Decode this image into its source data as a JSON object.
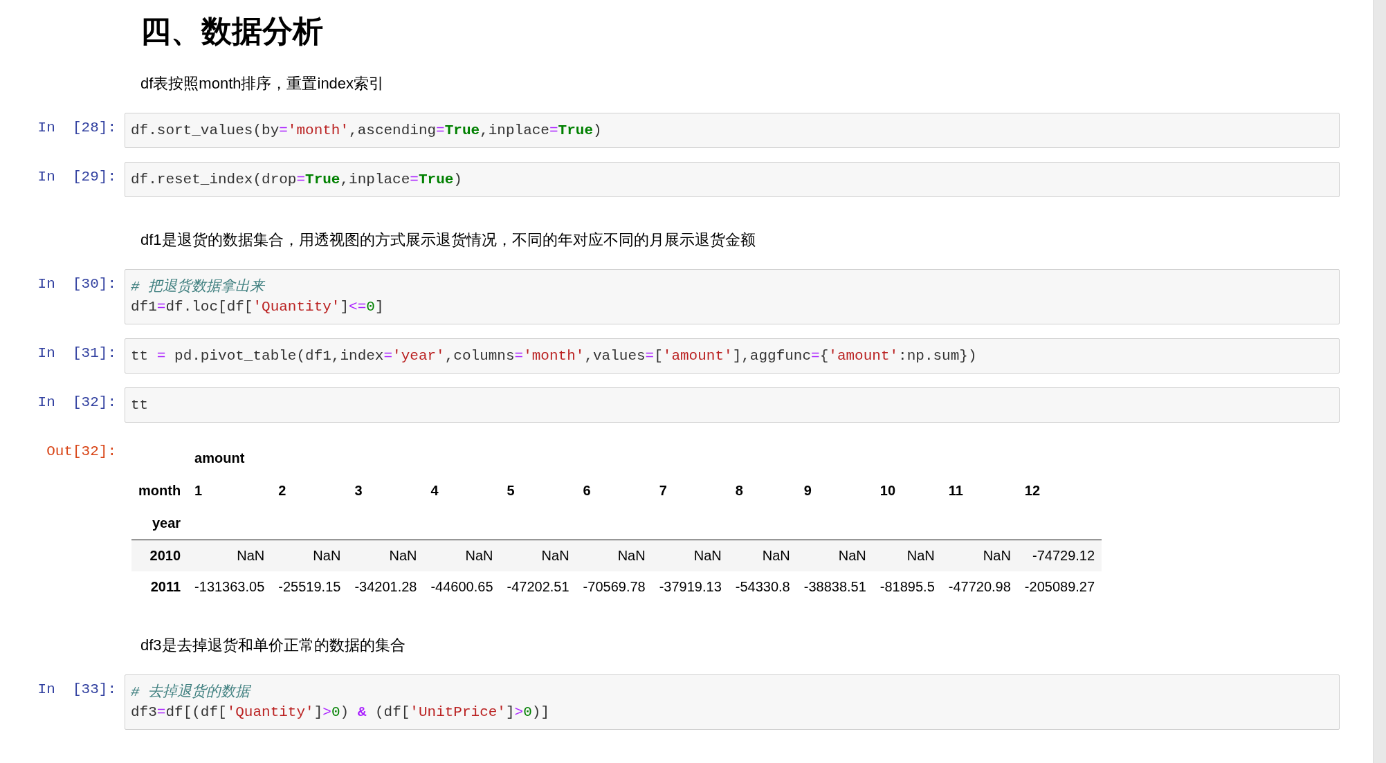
{
  "cells": [
    {
      "kind": "heading",
      "text": "四、数据分析"
    },
    {
      "kind": "markdown",
      "text": "df表按照month排序，重置index索引"
    },
    {
      "kind": "code",
      "prompt": "In  [28]:",
      "lines": [
        [
          {
            "t": "df.sort_values(by",
            "kind": "plain"
          },
          {
            "t": "=",
            "kind": "op"
          },
          {
            "t": "'month'",
            "kind": "str"
          },
          {
            "t": ",ascending",
            "kind": "plain"
          },
          {
            "t": "=",
            "kind": "op"
          },
          {
            "t": "True",
            "kind": "kw"
          },
          {
            "t": ",inplace",
            "kind": "plain"
          },
          {
            "t": "=",
            "kind": "op"
          },
          {
            "t": "True",
            "kind": "kw"
          },
          {
            "t": ")",
            "kind": "plain"
          }
        ]
      ]
    },
    {
      "kind": "code",
      "prompt": "In  [29]:",
      "lines": [
        [
          {
            "t": "df.reset_index(drop",
            "kind": "plain"
          },
          {
            "t": "=",
            "kind": "op"
          },
          {
            "t": "True",
            "kind": "kw"
          },
          {
            "t": ",inplace",
            "kind": "plain"
          },
          {
            "t": "=",
            "kind": "op"
          },
          {
            "t": "True",
            "kind": "kw"
          },
          {
            "t": ")",
            "kind": "plain"
          }
        ]
      ]
    },
    {
      "kind": "markdown",
      "text": "df1是退货的数据集合，用透视图的方式展示退货情况，不同的年对应不同的月展示退货金额"
    },
    {
      "kind": "code",
      "prompt": "In  [30]:",
      "lines": [
        [
          {
            "t": "# 把退货数据拿出来",
            "kind": "comment"
          }
        ],
        [
          {
            "t": "df1",
            "kind": "plain"
          },
          {
            "t": "=",
            "kind": "op"
          },
          {
            "t": "df.loc[df[",
            "kind": "plain"
          },
          {
            "t": "'Quantity'",
            "kind": "str"
          },
          {
            "t": "]",
            "kind": "plain"
          },
          {
            "t": "<=",
            "kind": "op"
          },
          {
            "t": "0",
            "kind": "num"
          },
          {
            "t": "]",
            "kind": "plain"
          }
        ]
      ]
    },
    {
      "kind": "code",
      "prompt": "In  [31]:",
      "lines": [
        [
          {
            "t": "tt ",
            "kind": "plain"
          },
          {
            "t": "=",
            "kind": "op"
          },
          {
            "t": " pd.pivot_table(df1,index",
            "kind": "plain"
          },
          {
            "t": "=",
            "kind": "op"
          },
          {
            "t": "'year'",
            "kind": "str"
          },
          {
            "t": ",columns",
            "kind": "plain"
          },
          {
            "t": "=",
            "kind": "op"
          },
          {
            "t": "'month'",
            "kind": "str"
          },
          {
            "t": ",values",
            "kind": "plain"
          },
          {
            "t": "=",
            "kind": "op"
          },
          {
            "t": "[",
            "kind": "plain"
          },
          {
            "t": "'amount'",
            "kind": "str"
          },
          {
            "t": "],aggfunc",
            "kind": "plain"
          },
          {
            "t": "=",
            "kind": "op"
          },
          {
            "t": "{",
            "kind": "plain"
          },
          {
            "t": "'amount'",
            "kind": "str"
          },
          {
            "t": ":np.sum})",
            "kind": "plain"
          }
        ]
      ]
    },
    {
      "kind": "code",
      "prompt": "In  [32]:",
      "lines": [
        [
          {
            "t": "tt",
            "kind": "plain"
          }
        ]
      ]
    },
    {
      "kind": "table",
      "prompt": "Out[32]:",
      "group": "amount",
      "column_index": "month",
      "columns": [
        "1",
        "2",
        "3",
        "4",
        "5",
        "6",
        "7",
        "8",
        "9",
        "10",
        "11",
        "12"
      ],
      "row_index": "year",
      "rows": [
        {
          "label": "2010",
          "values": [
            "NaN",
            "NaN",
            "NaN",
            "NaN",
            "NaN",
            "NaN",
            "NaN",
            "NaN",
            "NaN",
            "NaN",
            "NaN",
            "-74729.12"
          ]
        },
        {
          "label": "2011",
          "values": [
            "-131363.05",
            "-25519.15",
            "-34201.28",
            "-44600.65",
            "-47202.51",
            "-70569.78",
            "-37919.13",
            "-54330.8",
            "-38838.51",
            "-81895.5",
            "-47720.98",
            "-205089.27"
          ]
        }
      ]
    },
    {
      "kind": "markdown",
      "text": "df3是去掉退货和单价正常的数据的集合"
    },
    {
      "kind": "code",
      "prompt": "In  [33]:",
      "lines": [
        [
          {
            "t": "# 去掉退货的数据",
            "kind": "comment"
          }
        ],
        [
          {
            "t": "df3",
            "kind": "plain"
          },
          {
            "t": "=",
            "kind": "op"
          },
          {
            "t": "df[(df[",
            "kind": "plain"
          },
          {
            "t": "'Quantity'",
            "kind": "str"
          },
          {
            "t": "]",
            "kind": "plain"
          },
          {
            "t": ">",
            "kind": "op"
          },
          {
            "t": "0",
            "kind": "num"
          },
          {
            "t": ") ",
            "kind": "plain"
          },
          {
            "t": "&",
            "kind": "amp"
          },
          {
            "t": " (df[",
            "kind": "plain"
          },
          {
            "t": "'UnitPrice'",
            "kind": "str"
          },
          {
            "t": "]",
            "kind": "plain"
          },
          {
            "t": ">",
            "kind": "op"
          },
          {
            "t": "0",
            "kind": "num"
          },
          {
            "t": ")]",
            "kind": "plain"
          }
        ]
      ]
    }
  ]
}
